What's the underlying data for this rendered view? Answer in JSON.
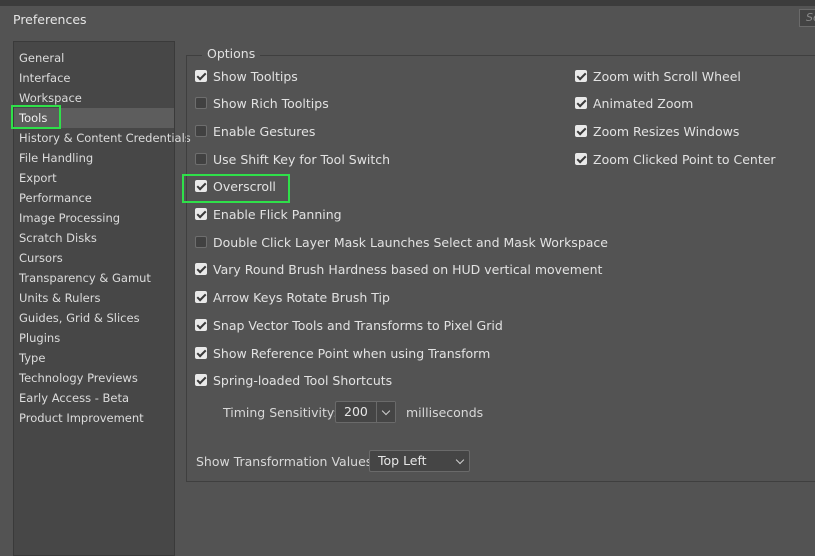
{
  "window": {
    "title": "Preferences",
    "search_placeholder": "Se"
  },
  "sidebar": {
    "items": [
      {
        "label": "General"
      },
      {
        "label": "Interface"
      },
      {
        "label": "Workspace"
      },
      {
        "label": "Tools",
        "selected": true
      },
      {
        "label": "History & Content Credentials"
      },
      {
        "label": "File Handling"
      },
      {
        "label": "Export"
      },
      {
        "label": "Performance"
      },
      {
        "label": "Image Processing"
      },
      {
        "label": "Scratch Disks"
      },
      {
        "label": "Cursors"
      },
      {
        "label": "Transparency & Gamut"
      },
      {
        "label": "Units & Rulers"
      },
      {
        "label": "Guides, Grid & Slices"
      },
      {
        "label": "Plugins"
      },
      {
        "label": "Type"
      },
      {
        "label": "Technology Previews"
      },
      {
        "label": "Early Access - Beta"
      },
      {
        "label": "Product Improvement"
      }
    ]
  },
  "options": {
    "group_label": "Options",
    "left": [
      {
        "label": "Show Tooltips",
        "checked": true
      },
      {
        "label": "Show Rich Tooltips",
        "checked": false
      },
      {
        "label": "Enable Gestures",
        "checked": false
      },
      {
        "label": "Use Shift Key for Tool Switch",
        "checked": false
      },
      {
        "label": "Overscroll",
        "checked": true
      },
      {
        "label": "Enable Flick Panning",
        "checked": true
      },
      {
        "label": "Double Click Layer Mask Launches Select and Mask Workspace",
        "checked": false
      },
      {
        "label": "Vary Round Brush Hardness based on HUD vertical movement",
        "checked": true
      },
      {
        "label": "Arrow Keys Rotate Brush Tip",
        "checked": true
      },
      {
        "label": "Snap Vector Tools and Transforms to Pixel Grid",
        "checked": true
      },
      {
        "label": "Show Reference Point when using Transform",
        "checked": true
      },
      {
        "label": "Spring-loaded Tool Shortcuts",
        "checked": true
      }
    ],
    "right": [
      {
        "label": "Zoom with Scroll Wheel",
        "checked": true
      },
      {
        "label": "Animated Zoom",
        "checked": true
      },
      {
        "label": "Zoom Resizes Windows",
        "checked": true
      },
      {
        "label": "Zoom Clicked Point to Center",
        "checked": true
      }
    ],
    "timing": {
      "label": "Timing Sensitivity:",
      "value": "200",
      "unit": "milliseconds"
    },
    "transform_values": {
      "label": "Show Transformation Values:",
      "value": "Top Left"
    }
  },
  "colors": {
    "highlight": "#2fe04a",
    "panel_bg": "#535353",
    "sidebar_bg": "#474747"
  }
}
